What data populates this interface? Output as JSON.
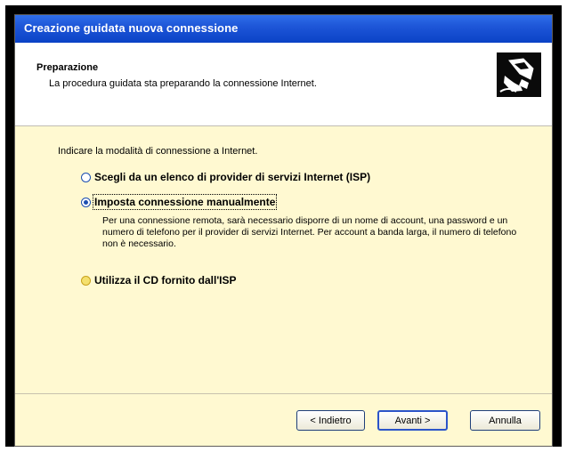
{
  "window": {
    "title": "Creazione guidata nuova connessione"
  },
  "header": {
    "title": "Preparazione",
    "subtitle": "La procedura guidata sta preparando la connessione Internet.",
    "icon": "network-wizard-icon"
  },
  "content": {
    "prompt": "Indicare la modalità di connessione a Internet.",
    "options": [
      {
        "label": "Scegli da un elenco di provider di servizi Internet (ISP)",
        "selected": false
      },
      {
        "label": "Imposta connessione manualmente",
        "selected": true
      },
      {
        "label": "Utilizza il CD fornito dall'ISP",
        "selected": false
      }
    ],
    "description": "Per una connessione remota, sarà necessario disporre di un nome di account, una password e un numero di telefono per il provider di servizi Internet. Per account a banda larga, il numero di telefono non è necessario."
  },
  "buttons": {
    "back": "< Indietro",
    "next": "Avanti >",
    "cancel": "Annulla"
  }
}
